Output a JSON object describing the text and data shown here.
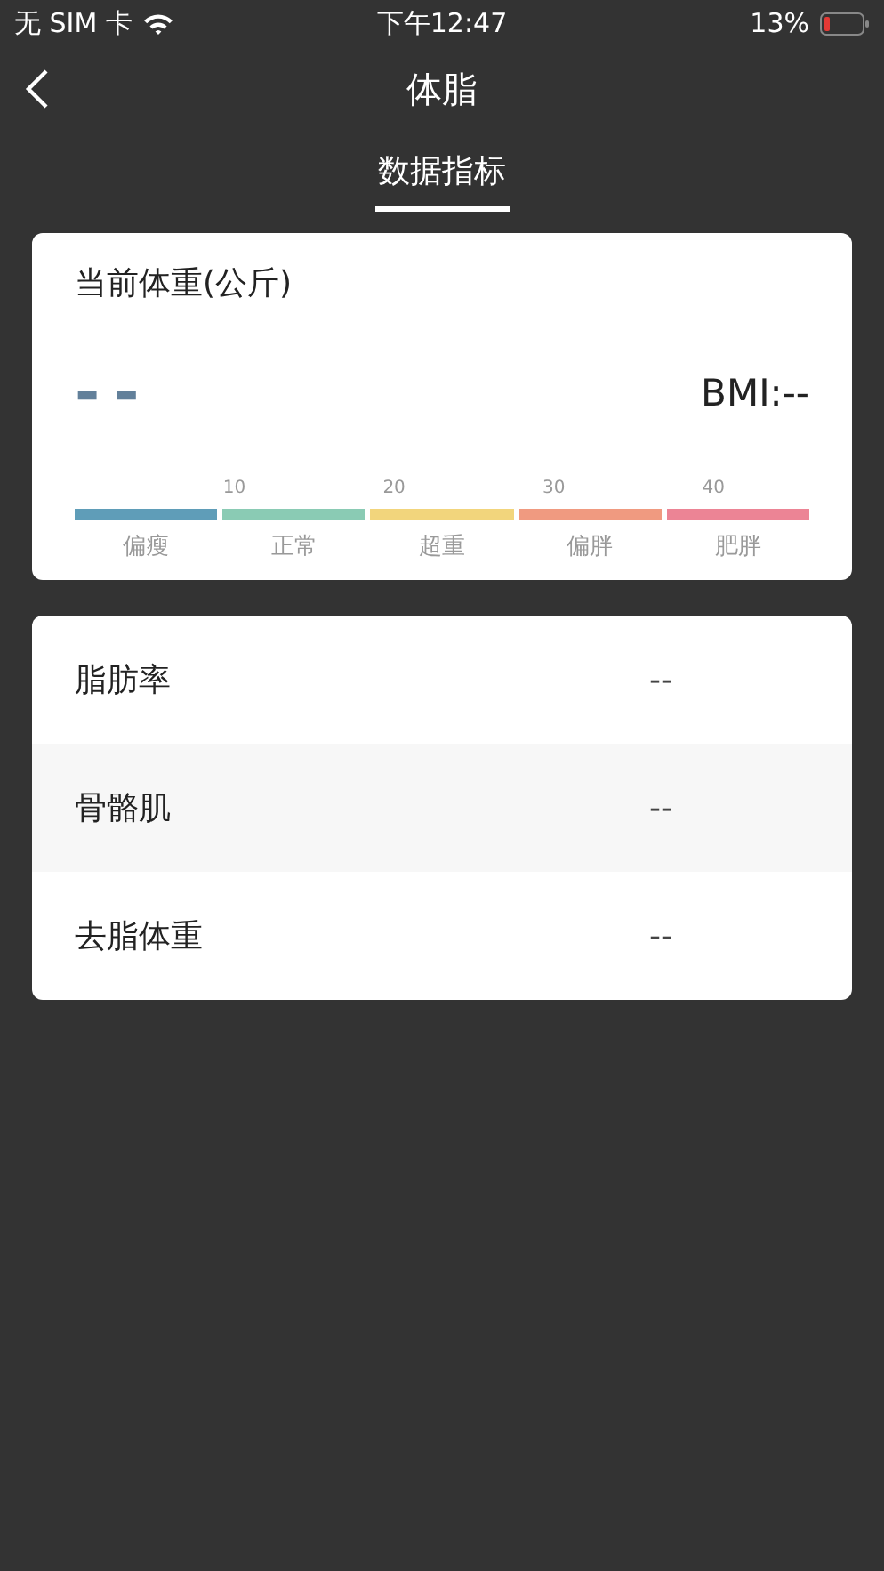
{
  "status_bar": {
    "carrier": "无 SIM 卡",
    "time": "下午12:47",
    "battery": "13%"
  },
  "nav": {
    "title": "体脂"
  },
  "tabs": [
    {
      "label": "数据指标",
      "selected": true
    }
  ],
  "weight_card": {
    "title": "当前体重(公斤)",
    "weight": "--",
    "bmi": "BMI:--",
    "ticks": [
      "10",
      "20",
      "30",
      "40"
    ],
    "segments": [
      {
        "label": "偏瘦",
        "color": "#5f9db8"
      },
      {
        "label": "正常",
        "color": "#8acbb4"
      },
      {
        "label": "超重",
        "color": "#f2d57c"
      },
      {
        "label": "偏胖",
        "color": "#f09a80"
      },
      {
        "label": "肥胖",
        "color": "#ec8495"
      }
    ]
  },
  "metrics": [
    {
      "name": "脂肪率",
      "value": "--"
    },
    {
      "name": "骨骼肌",
      "value": "--"
    },
    {
      "name": "去脂体重",
      "value": "--"
    }
  ]
}
